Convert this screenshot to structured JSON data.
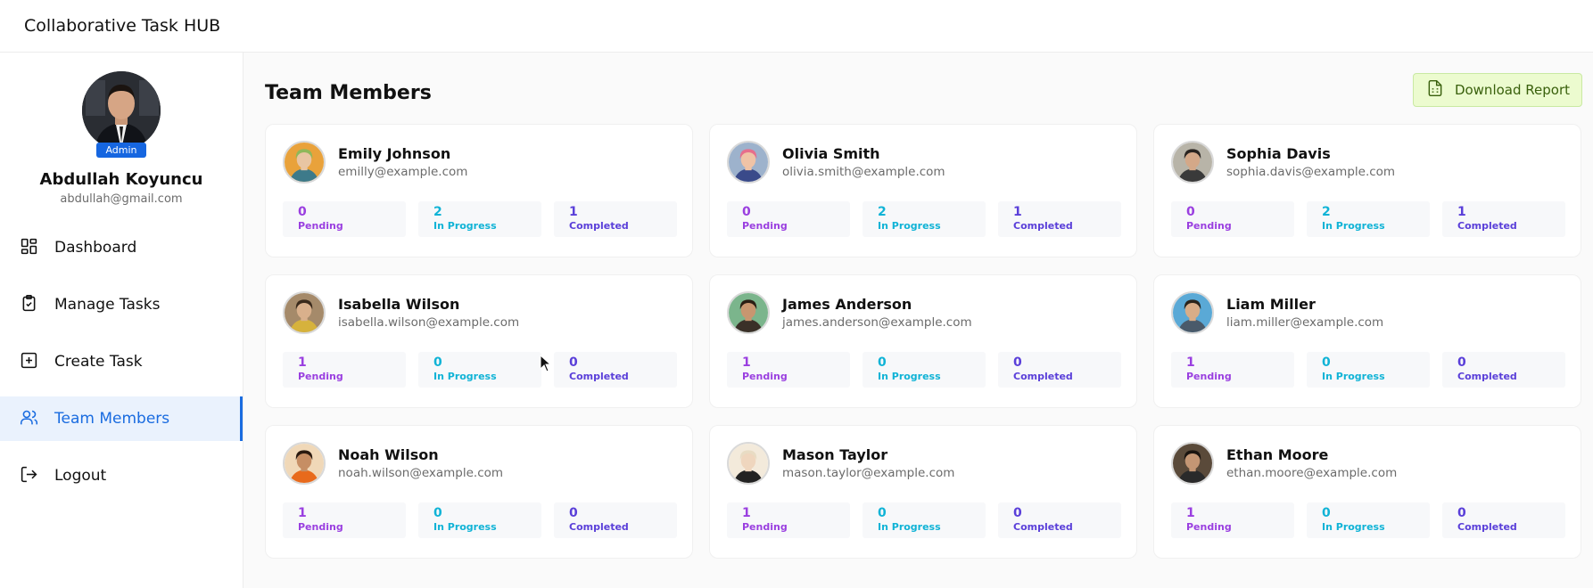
{
  "app": {
    "title": "Collaborative Task HUB"
  },
  "sidebar": {
    "badge": "Admin",
    "user_name": "Abdullah Koyuncu",
    "user_email": "abdullah@gmail.com",
    "items": [
      {
        "label": "Dashboard",
        "icon": "dashboard-icon"
      },
      {
        "label": "Manage Tasks",
        "icon": "clipboard-check-icon"
      },
      {
        "label": "Create Task",
        "icon": "plus-square-icon"
      },
      {
        "label": "Team Members",
        "icon": "users-icon",
        "active": true
      },
      {
        "label": "Logout",
        "icon": "logout-icon"
      }
    ]
  },
  "main": {
    "title": "Team Members",
    "download_label": "Download Report",
    "stat_labels": {
      "pending": "Pending",
      "in_progress": "In Progress",
      "completed": "Completed"
    },
    "members": [
      {
        "name": "Emily Johnson",
        "email": "emilly@example.com",
        "pending": "0",
        "in_progress": "2",
        "completed": "1"
      },
      {
        "name": "Olivia Smith",
        "email": "olivia.smith@example.com",
        "pending": "0",
        "in_progress": "2",
        "completed": "1"
      },
      {
        "name": "Sophia Davis",
        "email": "sophia.davis@example.com",
        "pending": "0",
        "in_progress": "2",
        "completed": "1"
      },
      {
        "name": "Isabella Wilson",
        "email": "isabella.wilson@example.com",
        "pending": "1",
        "in_progress": "0",
        "completed": "0"
      },
      {
        "name": "James Anderson",
        "email": "james.anderson@example.com",
        "pending": "1",
        "in_progress": "0",
        "completed": "0"
      },
      {
        "name": "Liam Miller",
        "email": "liam.miller@example.com",
        "pending": "1",
        "in_progress": "0",
        "completed": "0"
      },
      {
        "name": "Noah Wilson",
        "email": "noah.wilson@example.com",
        "pending": "1",
        "in_progress": "0",
        "completed": "0"
      },
      {
        "name": "Mason Taylor",
        "email": "mason.taylor@example.com",
        "pending": "1",
        "in_progress": "0",
        "completed": "0"
      },
      {
        "name": "Ethan Moore",
        "email": "ethan.moore@example.com",
        "pending": "1",
        "in_progress": "0",
        "completed": "0"
      }
    ]
  },
  "colors": {
    "accent": "#1a6ce0",
    "pending": "#9a3fe0",
    "in_progress": "#10b3d6",
    "completed": "#5a3fd9",
    "download_bg": "#ecfbcf"
  }
}
